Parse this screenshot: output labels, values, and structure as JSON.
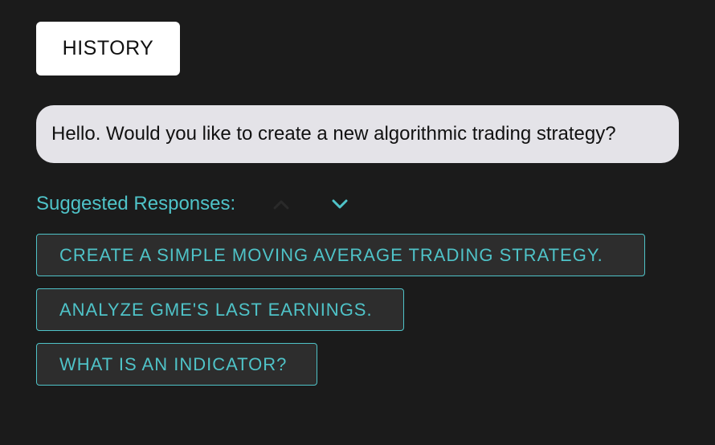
{
  "history_button": {
    "label": "HISTORY"
  },
  "chat": {
    "message": "Hello. Would you like to create a new algorithmic trading strategy?"
  },
  "suggestions": {
    "label": "Suggested Responses:",
    "collapse_icon": "chevron-up-icon",
    "expand_icon": "chevron-down-icon",
    "items": [
      {
        "label": "CREATE A SIMPLE MOVING AVERAGE TRADING STRATEGY."
      },
      {
        "label": "ANALYZE GME'S LAST EARNINGS."
      },
      {
        "label": "WHAT IS AN INDICATOR?"
      }
    ]
  },
  "colors": {
    "background": "#1b1b1b",
    "accent": "#4fc3c8",
    "bubble": "#e4e3e8",
    "button_bg": "#2d2d2d"
  }
}
